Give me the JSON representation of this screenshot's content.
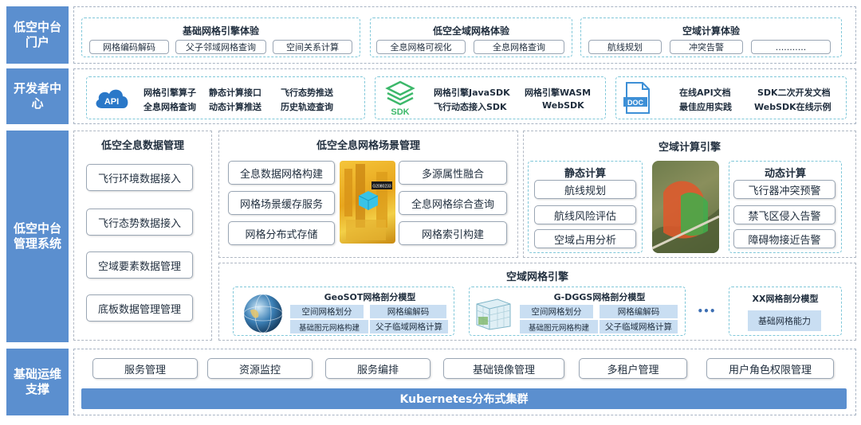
{
  "rows": {
    "portal": "低空中台门户",
    "dev": "开发者中心",
    "mgmt": "低空中台管理系统",
    "ops": "基础运维支撑"
  },
  "portal": {
    "g1": {
      "title": "基础网格引擎体验",
      "items": [
        "网格编码解码",
        "父子邻域网格查询",
        "空间关系计算"
      ]
    },
    "g2": {
      "title": "低空全域网格体验",
      "items": [
        "全息网格可视化",
        "全息网格查询"
      ]
    },
    "g3": {
      "title": "空域计算体验",
      "items": [
        "航线规划",
        "冲突告警",
        "..........."
      ]
    }
  },
  "dev": {
    "api": {
      "icon_label": "API",
      "items": [
        "网格引擎算子",
        "静态计算接口",
        "飞行态势推送",
        "全息网格查询",
        "动态计算推送",
        "历史轨迹查询"
      ]
    },
    "sdk": {
      "icon_label": "SDK",
      "items": [
        "网格引擎JavaSDK",
        "网格引擎WASM",
        "飞行动态接入SDK",
        "WebSDK"
      ]
    },
    "doc": {
      "icon_label": "DOC",
      "items": [
        "在线API文档",
        "SDK二次开发文档",
        "最佳应用实践",
        "WebSDK在线示例"
      ]
    }
  },
  "mgmt": {
    "data": {
      "title": "低空全息数据管理",
      "items": [
        "飞行环境数据接入",
        "飞行态势数据接入",
        "空域要素数据管理",
        "底板数据管理管理"
      ]
    },
    "scene": {
      "title": "低空全息网格场景管理",
      "left": [
        "全息数据网格构建",
        "网格场景缓存服务",
        "网格分布式存储"
      ],
      "right": [
        "多源属性融合",
        "全息网格综合查询",
        "网格索引构建"
      ],
      "img_tag": "G2080233"
    },
    "compute": {
      "title": "空域计算引擎",
      "static_title": "静态计算",
      "static": [
        "航线规划",
        "航线风险评估",
        "空域占用分析"
      ],
      "dynamic_title": "动态计算",
      "dynamic": [
        "飞行器冲突预警",
        "禁飞区侵入告警",
        "障碍物接近告警"
      ]
    },
    "grid": {
      "title": "空域网格引擎",
      "geosot": {
        "title": "GeoSOT网格剖分模型",
        "cells": [
          "空间网格划分",
          "网格编解码",
          "基础图元网格构建",
          "父子临域网格计算"
        ]
      },
      "gdggs": {
        "title": "G-DGGS网格剖分模型",
        "cells": [
          "空间网格划分",
          "网格编解码",
          "基础图元网格构建",
          "父子临域网格计算"
        ]
      },
      "dots": "•••",
      "xx": {
        "title": "XX网格剖分模型",
        "cell": "基础网格能力"
      }
    }
  },
  "ops": {
    "items": [
      "服务管理",
      "资源监控",
      "服务编排",
      "基础镜像管理",
      "多租户管理",
      "用户角色权限管理"
    ],
    "k8s": "Kubernetes分布式集群"
  },
  "colors": {
    "label_bg": "#5b8fcf",
    "dash": "#7fc7d9",
    "cell": "#c9def2",
    "api": "#2a78c8",
    "sdk": "#3cb86a",
    "doc": "#3d8fd6"
  }
}
